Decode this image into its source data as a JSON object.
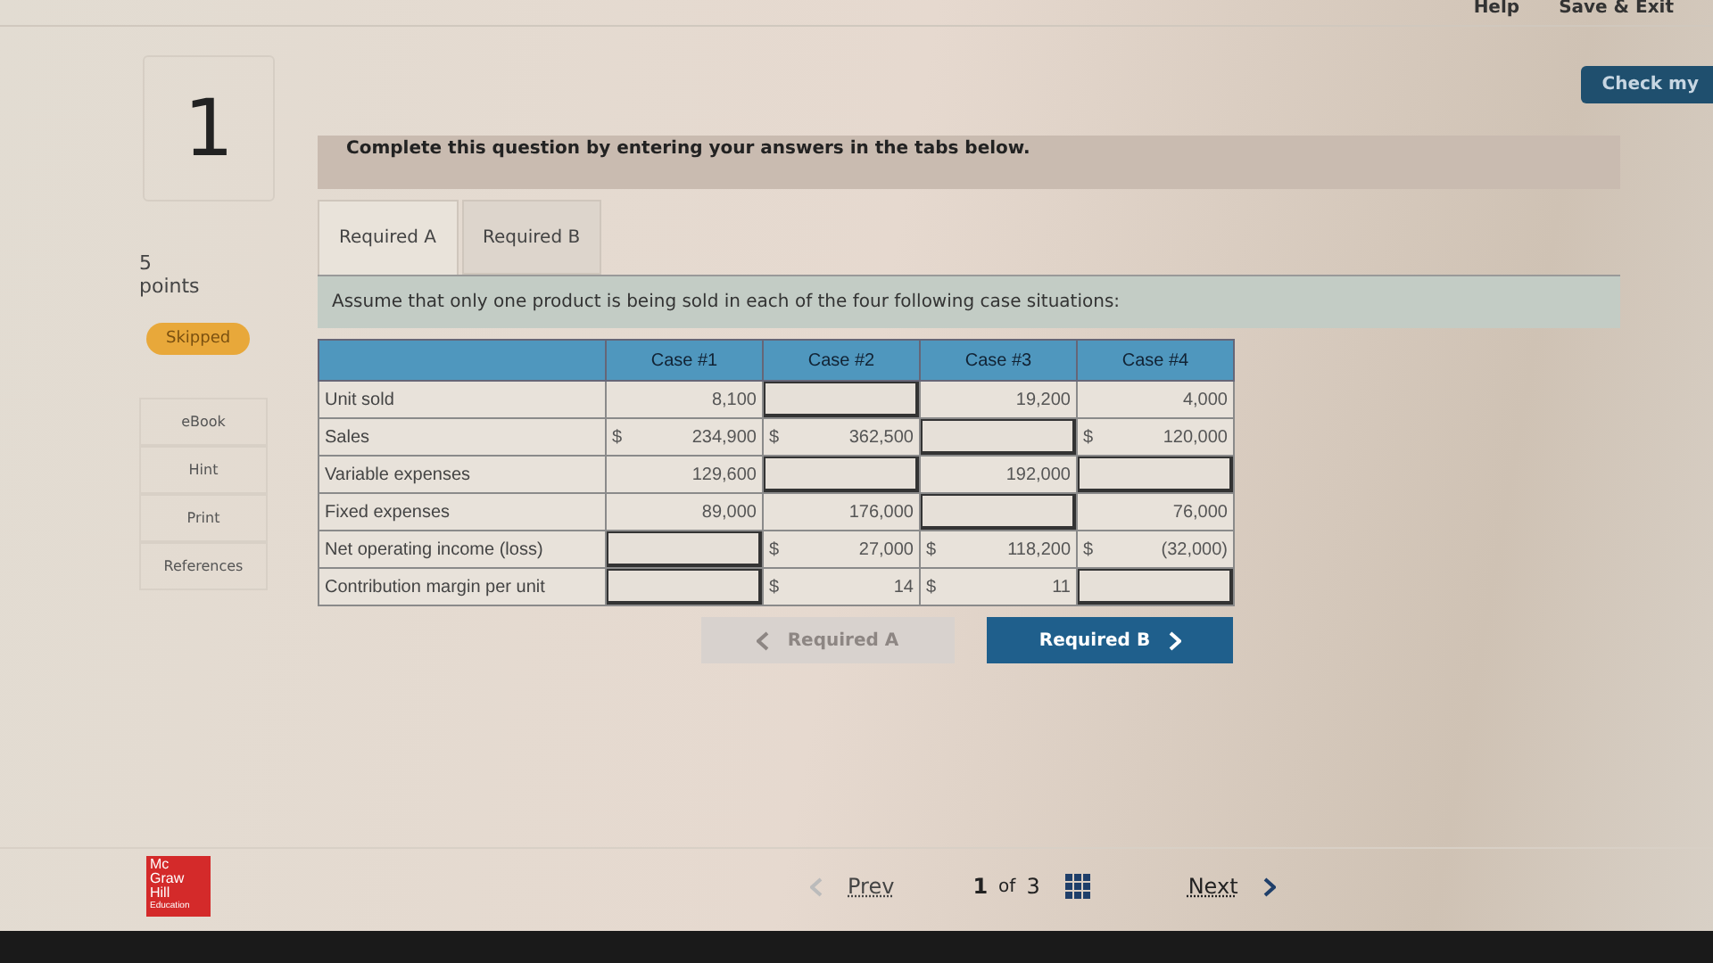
{
  "top_bar": {
    "links": [
      "Help",
      "Save & Exit"
    ]
  },
  "check_button": "Check my",
  "question": {
    "number": "1",
    "points": "5",
    "points_label": "points",
    "status": "Skipped"
  },
  "side_tools": [
    "eBook",
    "Hint",
    "Print",
    "References"
  ],
  "instruction": "Complete this question by entering your answers in the tabs below.",
  "tabs": [
    {
      "label": "Required A",
      "selected": true
    },
    {
      "label": "Required B",
      "selected": false
    }
  ],
  "prompt": "Assume that only one product is being sold in each of the four following case situations:",
  "table": {
    "columns": [
      "Case #1",
      "Case #2",
      "Case #3",
      "Case #4"
    ],
    "rows": [
      {
        "label": "Unit sold",
        "cells": [
          {
            "kind": "given",
            "value": "8,100"
          },
          {
            "kind": "input"
          },
          {
            "kind": "given",
            "value": "19,200"
          },
          {
            "kind": "given",
            "value": "4,000"
          }
        ]
      },
      {
        "label": "Sales",
        "cells": [
          {
            "kind": "given",
            "currency": "$",
            "value": "234,900"
          },
          {
            "kind": "given",
            "currency": "$",
            "value": "362,500"
          },
          {
            "kind": "input"
          },
          {
            "kind": "given",
            "currency": "$",
            "value": "120,000"
          }
        ]
      },
      {
        "label": "Variable expenses",
        "cells": [
          {
            "kind": "given",
            "value": "129,600"
          },
          {
            "kind": "input"
          },
          {
            "kind": "given",
            "value": "192,000"
          },
          {
            "kind": "input"
          }
        ]
      },
      {
        "label": "Fixed expenses",
        "cells": [
          {
            "kind": "given",
            "value": "89,000"
          },
          {
            "kind": "given",
            "value": "176,000"
          },
          {
            "kind": "input"
          },
          {
            "kind": "given",
            "value": "76,000"
          }
        ]
      },
      {
        "label": "Net operating income (loss)",
        "cells": [
          {
            "kind": "input"
          },
          {
            "kind": "given",
            "currency": "$",
            "value": "27,000"
          },
          {
            "kind": "given",
            "currency": "$",
            "value": "118,200"
          },
          {
            "kind": "given",
            "currency": "$",
            "value": "(32,000)"
          }
        ]
      },
      {
        "label": "Contribution margin per unit",
        "cells": [
          {
            "kind": "input"
          },
          {
            "kind": "given",
            "currency": "$",
            "value": "14"
          },
          {
            "kind": "given",
            "currency": "$",
            "value": "11"
          },
          {
            "kind": "input"
          }
        ]
      }
    ]
  },
  "nav_buttons": [
    {
      "label": "Required A",
      "kind": "prev",
      "disabled": true
    },
    {
      "label": "Required B",
      "kind": "next",
      "disabled": false
    }
  ],
  "footer": {
    "logo": [
      "Mc",
      "Graw",
      "Hill",
      "Education"
    ],
    "prev": "Prev",
    "page": "1",
    "of": "of",
    "total": "3",
    "next": "Next"
  }
}
